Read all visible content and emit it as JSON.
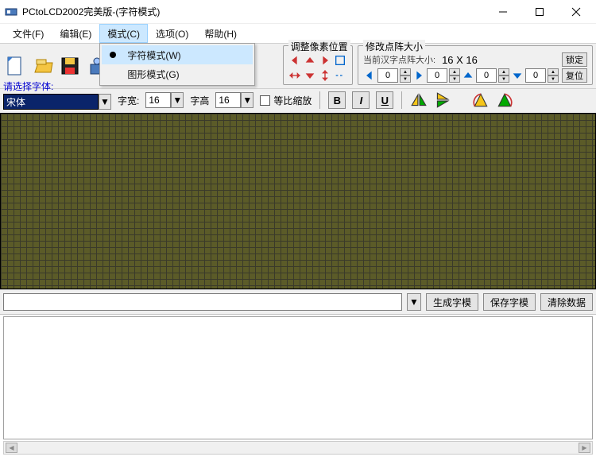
{
  "title": "PCtoLCD2002完美版-(字符模式)",
  "menus": {
    "file": "文件(F)",
    "edit": "编辑(E)",
    "mode": "模式(C)",
    "options": "选项(O)",
    "help": "帮助(H)"
  },
  "mode_dropdown": {
    "char_mode": "字符模式(W)",
    "graphic_mode": "图形模式(G)"
  },
  "pixel_pos_group": "调整像素位置",
  "dot_matrix_group": "修改点阵大小",
  "current_size_label": "当前汉字点阵大小:",
  "current_size_value": "16 X 16",
  "lock_btn": "锁定",
  "reset_btn": "复位",
  "offset": {
    "a": "0",
    "b": "0",
    "c": "0",
    "d": "0"
  },
  "font_prompt": "请选择字体:",
  "font_value": "宋体",
  "char_width_label": "字宽:",
  "char_width_value": "16",
  "char_height_label": "字高",
  "char_height_value": "16",
  "scale_checkbox": "等比缩放",
  "fmt": {
    "bold": "B",
    "italic": "I",
    "underline": "U"
  },
  "buttons": {
    "gen": "生成字模",
    "save": "保存字模",
    "clear": "清除数据"
  }
}
